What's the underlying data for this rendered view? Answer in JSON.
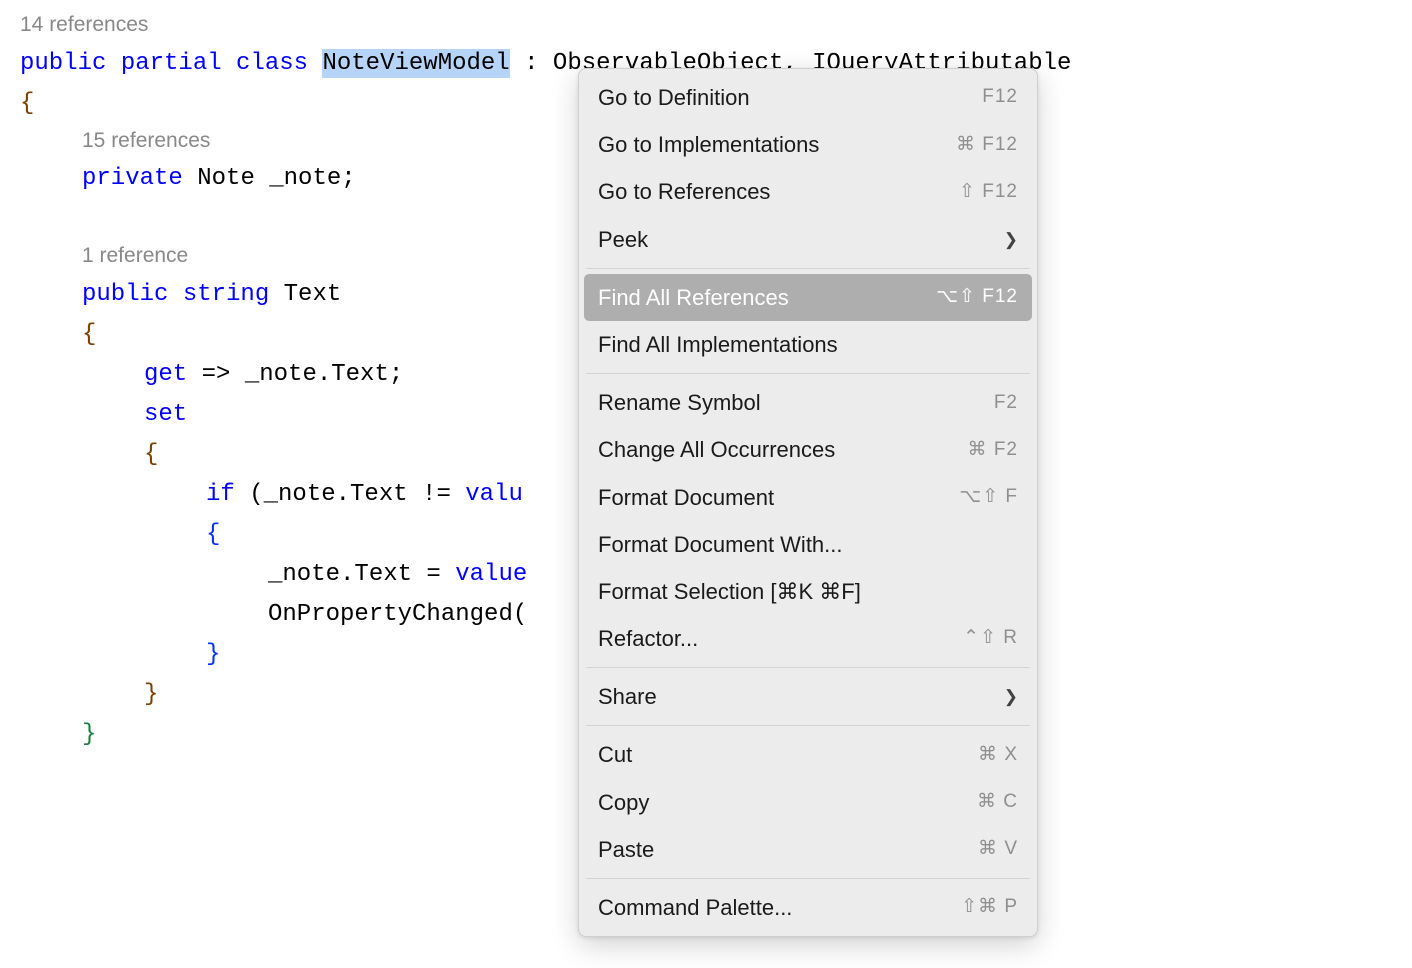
{
  "code": {
    "ref14": "14 references",
    "line1_public": "public",
    "line1_partial": " partial",
    "line1_class": " class",
    "line1_space": " ",
    "line1_classname": "NoteViewModel",
    "line1_rest": " : ObservableObject, IQueryAttributable",
    "brace_open": "{",
    "ref15": "15 references",
    "line2_private": "private",
    "line2_rest": " Note _note;",
    "ref1": "1 reference",
    "line3_public": "public",
    "line3_string": " string",
    "line3_rest": " Text",
    "line4_brace": "{",
    "line5_get": "get",
    "line5_rest": " => _note.Text;",
    "line6_set": "set",
    "line7_brace": "{",
    "line8_if": "if",
    "line8_rest": " (_note.Text != ",
    "line8_value": "valu",
    "line9_brace": "{",
    "line10_rest": "_note.Text = ",
    "line10_value": "value",
    "line11_rest": "OnPropertyChanged(",
    "line12_brace": "}",
    "line13_brace": "}",
    "line14_brace": "}"
  },
  "menu": {
    "items": [
      {
        "label": "Go to Definition",
        "shortcut": "F12"
      },
      {
        "label": "Go to Implementations",
        "shortcut": "⌘ F12"
      },
      {
        "label": "Go to References",
        "shortcut": "⇧ F12"
      },
      {
        "label": "Peek",
        "submenu": true
      }
    ],
    "items2": [
      {
        "label": "Find All References",
        "shortcut": "⌥⇧ F12",
        "highlighted": true
      },
      {
        "label": "Find All Implementations"
      }
    ],
    "items3": [
      {
        "label": "Rename Symbol",
        "shortcut": "F2"
      },
      {
        "label": "Change All Occurrences",
        "shortcut": "⌘ F2"
      },
      {
        "label": "Format Document",
        "shortcut": "⌥⇧ F"
      },
      {
        "label": "Format Document With..."
      },
      {
        "label": "Format Selection [⌘K ⌘F]"
      },
      {
        "label": "Refactor...",
        "shortcut": "⌃⇧ R"
      }
    ],
    "items4": [
      {
        "label": "Share",
        "submenu": true
      }
    ],
    "items5": [
      {
        "label": "Cut",
        "shortcut": "⌘ X"
      },
      {
        "label": "Copy",
        "shortcut": "⌘ C"
      },
      {
        "label": "Paste",
        "shortcut": "⌘ V"
      }
    ],
    "items6": [
      {
        "label": "Command Palette...",
        "shortcut": "⇧⌘ P"
      }
    ]
  }
}
